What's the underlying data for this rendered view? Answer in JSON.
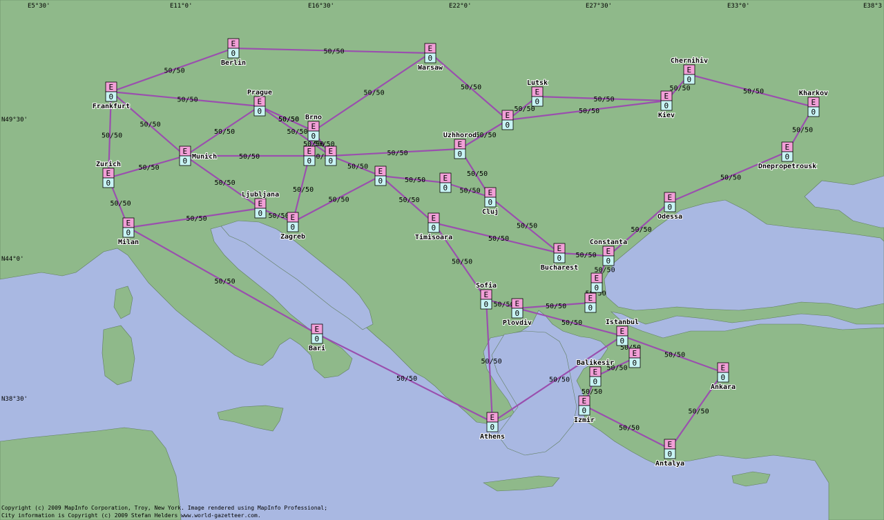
{
  "colors": {
    "sea": "#a9b8e2",
    "land": "#8fb98a",
    "link": "#9a4fae",
    "box_top": "#f2a0d8",
    "box_bottom": "#c8f4f4"
  },
  "coords": {
    "top": [
      "E5°30'",
      "E11°0'",
      "E16°30'",
      "E22°0'",
      "E27°30'",
      "E33°0'",
      "E38°3"
    ],
    "left": [
      "N49°30'",
      "N44°0'",
      "N38°30'"
    ]
  },
  "node_box": {
    "top": "E",
    "bottom": "0"
  },
  "nodes": [
    {
      "id": "berlin",
      "name": "Berlin"
    },
    {
      "id": "warsaw",
      "name": "Warsaw"
    },
    {
      "id": "frankfurt",
      "name": "Frankfurt"
    },
    {
      "id": "prague",
      "name": "Prague"
    },
    {
      "id": "brno",
      "name": "Brno"
    },
    {
      "id": "munich",
      "name": "Munich"
    },
    {
      "id": "zurich",
      "name": "Zurich"
    },
    {
      "id": "milan",
      "name": "Milan"
    },
    {
      "id": "ljubljana",
      "name": "Ljubljana"
    },
    {
      "id": "zagreb",
      "name": "Zagreb"
    },
    {
      "id": "vienna",
      "name": ""
    },
    {
      "id": "bratislava",
      "name": ""
    },
    {
      "id": "budapest",
      "name": ""
    },
    {
      "id": "debrecen",
      "name": ""
    },
    {
      "id": "cluj",
      "name": "Cluj"
    },
    {
      "id": "uzhhorod",
      "name": "Uzhhorod"
    },
    {
      "id": "lviv",
      "name": ""
    },
    {
      "id": "lutsk",
      "name": "Lutsk"
    },
    {
      "id": "kiev",
      "name": "Kiev"
    },
    {
      "id": "chernihiv",
      "name": "Chernihiv"
    },
    {
      "id": "kharkov",
      "name": "Kharkov"
    },
    {
      "id": "dnepr",
      "name": "Dnepropetrousk"
    },
    {
      "id": "odessa",
      "name": "Odessa"
    },
    {
      "id": "constanta",
      "name": "Constanta"
    },
    {
      "id": "bucharest",
      "name": "Bucharest"
    },
    {
      "id": "timisoara",
      "name": "Timisoara"
    },
    {
      "id": "sofia",
      "name": "Sofia"
    },
    {
      "id": "plovdiv",
      "name": "Plovdiv"
    },
    {
      "id": "varna",
      "name": ""
    },
    {
      "id": "burgas",
      "name": ""
    },
    {
      "id": "istanbul",
      "name": "Istanbul"
    },
    {
      "id": "bursa",
      "name": ""
    },
    {
      "id": "balikesir",
      "name": "Balikesir"
    },
    {
      "id": "izmir",
      "name": "Izmir"
    },
    {
      "id": "ankara",
      "name": "Ankara"
    },
    {
      "id": "antalya",
      "name": "Antalya"
    },
    {
      "id": "athens",
      "name": "Athens"
    },
    {
      "id": "bari",
      "name": "Bari"
    }
  ],
  "link_label": "50/50",
  "copyright": [
    "Copyright (c) 2009 MapInfo Corporation, Troy, New York. Image rendered using MapInfo Professional;",
    "City information is Copyright (c) 2009 Stefan Helders www.world-gazetteer.com."
  ]
}
